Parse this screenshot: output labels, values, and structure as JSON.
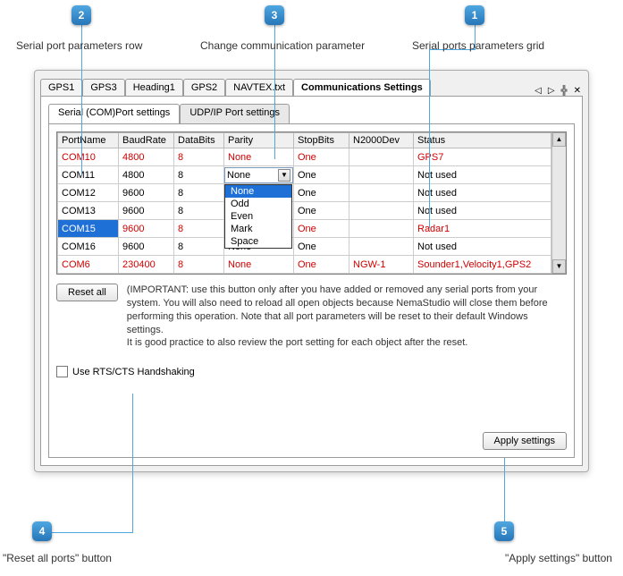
{
  "callouts": {
    "c1": {
      "num": "1",
      "label": "Serial ports parameters grid"
    },
    "c2": {
      "num": "2",
      "label": "Serial port parameters row"
    },
    "c3": {
      "num": "3",
      "label": "Change communication parameter"
    },
    "c4": {
      "num": "4",
      "label": "\"Reset all ports\" button"
    },
    "c5": {
      "num": "5",
      "label": "\"Apply settings\" button"
    }
  },
  "tabs": {
    "t0": "GPS1",
    "t1": "GPS3",
    "t2": "Heading1",
    "t3": "GPS2",
    "t4": "NAVTEX.txt",
    "t5": "Communications Settings"
  },
  "tabctrl": {
    "left": "◁",
    "right": "▷",
    "pin": "╬",
    "close": "✕"
  },
  "subtabs": {
    "s0": "Serial (COM)Port settings",
    "s1": "UDP/IP Port settings"
  },
  "grid": {
    "headers": {
      "c0": "PortName",
      "c1": "BaudRate",
      "c2": "DataBits",
      "c3": "Parity",
      "c4": "StopBits",
      "c5": "N2000Dev",
      "c6": "Status"
    },
    "r0": {
      "port": "COM10",
      "baud": "4800",
      "bits": "8",
      "parity": "None",
      "stop": "One",
      "n2k": "",
      "status": "GPS7"
    },
    "r1": {
      "port": "COM11",
      "baud": "4800",
      "bits": "8",
      "parity": "None",
      "stop": "One",
      "n2k": "",
      "status": "Not used"
    },
    "r2": {
      "port": "COM12",
      "baud": "9600",
      "bits": "8",
      "parity": "",
      "stop": "One",
      "n2k": "",
      "status": "Not used"
    },
    "r3": {
      "port": "COM13",
      "baud": "9600",
      "bits": "8",
      "parity": "",
      "stop": "One",
      "n2k": "",
      "status": "Not used"
    },
    "r4": {
      "port": "COM15",
      "baud": "9600",
      "bits": "8",
      "parity": "",
      "stop": "One",
      "n2k": "",
      "status": "Radar1"
    },
    "r5": {
      "port": "COM16",
      "baud": "9600",
      "bits": "8",
      "parity": "None",
      "stop": "One",
      "n2k": "",
      "status": "Not used"
    },
    "r6": {
      "port": "COM6",
      "baud": "230400",
      "bits": "8",
      "parity": "None",
      "stop": "One",
      "n2k": "NGW-1",
      "status": "Sounder1,Velocity1,GPS2"
    }
  },
  "dropdown": {
    "o0": "None",
    "o1": "Odd",
    "o2": "Even",
    "o3": "Mark",
    "o4": "Space"
  },
  "buttons": {
    "reset": "Reset all",
    "apply": "Apply settings"
  },
  "note": "(IMPORTANT: use this button only after you have added or removed any serial ports from your system. You will also need to reload all open objects because NemaStudio will close them before performing this operation. Note that all port parameters will be reset to their default Windows settings.\nIt is good practice to also review the port setting for each object after the reset.",
  "checkbox": {
    "label": "Use RTS/CTS Handshaking"
  }
}
